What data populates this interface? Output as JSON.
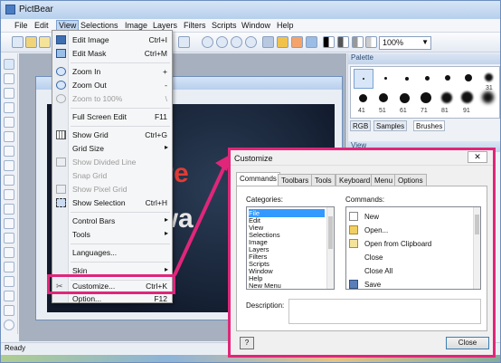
{
  "app": {
    "title": "PictBear"
  },
  "menubar": [
    "File",
    "Edit",
    "View",
    "Selections",
    "Image",
    "Layers",
    "Filters",
    "Scripts",
    "Window",
    "Help"
  ],
  "toolbar": {
    "zoom_value": "100%"
  },
  "view_menu": {
    "items": [
      {
        "label": "Edit Image",
        "shortcut": "Ctrl+I",
        "disabled": false,
        "icon": "image-icon"
      },
      {
        "label": "Edit Mask",
        "shortcut": "Ctrl+M",
        "disabled": false,
        "icon": "mask-icon"
      },
      {
        "label": "Zoom In",
        "shortcut": "+",
        "disabled": false,
        "icon": "zoom-in-icon"
      },
      {
        "label": "Zoom Out",
        "shortcut": "-",
        "disabled": false,
        "icon": "zoom-out-icon"
      },
      {
        "label": "Zoom to 100%",
        "shortcut": "\\",
        "disabled": true,
        "icon": "zoom-100-icon"
      },
      {
        "label": "Full Screen Edit",
        "shortcut": "F11",
        "disabled": false,
        "icon": ""
      },
      {
        "label": "Show Grid",
        "shortcut": "Ctrl+G",
        "disabled": false,
        "icon": "grid-icon"
      },
      {
        "label": "Grid Size",
        "shortcut": "",
        "disabled": false,
        "icon": "",
        "submenu": true
      },
      {
        "label": "Show Divided Line",
        "shortcut": "",
        "disabled": true,
        "icon": "divided-line-icon"
      },
      {
        "label": "Snap Grid",
        "shortcut": "",
        "disabled": true,
        "icon": ""
      },
      {
        "label": "Show Pixel Grid",
        "shortcut": "",
        "disabled": true,
        "icon": "pixel-grid-icon"
      },
      {
        "label": "Show Selection",
        "shortcut": "Ctrl+H",
        "disabled": false,
        "icon": "selection-icon"
      },
      {
        "label": "Control Bars",
        "shortcut": "",
        "disabled": false,
        "icon": "",
        "submenu": true
      },
      {
        "label": "Tools",
        "shortcut": "",
        "disabled": false,
        "icon": "",
        "submenu": true
      },
      {
        "label": "Languages...",
        "shortcut": "",
        "disabled": false,
        "icon": ""
      },
      {
        "label": "Skin",
        "shortcut": "",
        "disabled": false,
        "icon": "",
        "submenu": true
      },
      {
        "label": "Customize...",
        "shortcut": "Ctrl+K",
        "disabled": false,
        "icon": "customize-icon"
      },
      {
        "label": "Option...",
        "shortcut": "F12",
        "disabled": false,
        "icon": ""
      }
    ]
  },
  "document": {
    "text_line1": "Fre",
    "text_line2": "rwa"
  },
  "palette": {
    "title": "Palette",
    "brush_numbers": [
      "31",
      "41",
      "51",
      "61",
      "71",
      "81",
      "91"
    ],
    "tabs": [
      "RGB",
      "Samples",
      "Brushes"
    ]
  },
  "view_panel": {
    "title": "View"
  },
  "status": {
    "text": "Ready"
  },
  "dialog": {
    "title": "Customize",
    "close_glyph": "✕",
    "tabs": [
      "Commands",
      "Toolbars",
      "Tools",
      "Keyboard",
      "Menu",
      "Options"
    ],
    "categories_label": "Categories:",
    "commands_label": "Commands:",
    "categories": [
      "File",
      "Edit",
      "View",
      "Selections",
      "Image",
      "Layers",
      "Filters",
      "Scripts",
      "Window",
      "Help",
      "New Menu"
    ],
    "commands": [
      {
        "label": "New",
        "icon": "new-file-icon"
      },
      {
        "label": "Open...",
        "icon": "open-folder-icon"
      },
      {
        "label": "Open from Clipboard",
        "icon": "clipboard-icon"
      },
      {
        "label": "Close",
        "icon": ""
      },
      {
        "label": "Close All",
        "icon": ""
      },
      {
        "label": "Save",
        "icon": "save-icon"
      }
    ],
    "description_label": "Description:",
    "help_glyph": "?",
    "close_button": "Close"
  },
  "colors": {
    "highlight": "#e0267a",
    "selection": "#3399ff"
  }
}
